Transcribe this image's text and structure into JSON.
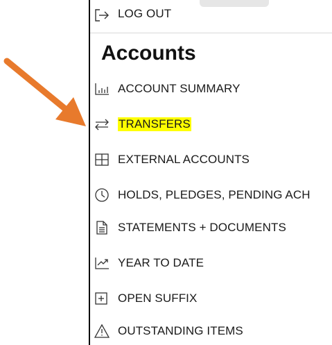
{
  "menu": {
    "logout_label": "LOG OUT",
    "section_title": "Accounts",
    "items": [
      {
        "label": "ACCOUNT SUMMARY",
        "icon": "bar-chart-icon"
      },
      {
        "label": "TRANSFERS",
        "icon": "transfer-arrows-icon",
        "highlighted": true
      },
      {
        "label": "EXTERNAL ACCOUNTS",
        "icon": "grid-icon"
      },
      {
        "label": "HOLDS, PLEDGES, PENDING ACH",
        "icon": "clock-icon"
      },
      {
        "label": "STATEMENTS + DOCUMENTS",
        "icon": "document-icon"
      },
      {
        "label": "YEAR TO DATE",
        "icon": "trend-chart-icon"
      },
      {
        "label": "OPEN SUFFIX",
        "icon": "plus-box-icon"
      },
      {
        "label": "OUTSTANDING ITEMS",
        "icon": "warning-icon"
      }
    ]
  },
  "colors": {
    "highlight": "#ffff00",
    "annotation_arrow": "#e87a2c",
    "text": "#1a1a1a"
  }
}
